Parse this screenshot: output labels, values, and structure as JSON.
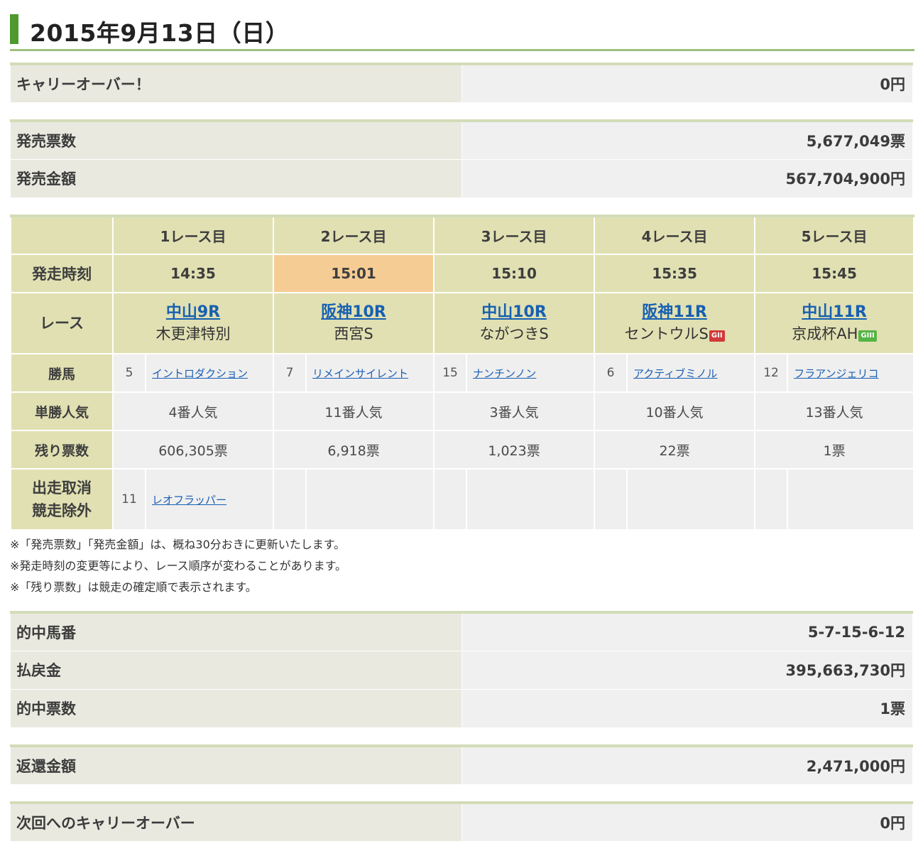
{
  "title": "2015年9月13日（日）",
  "carryover": {
    "label": "キャリーオーバー！",
    "value": "0円"
  },
  "sales": [
    {
      "label": "発売票数",
      "value": "5,677,049票"
    },
    {
      "label": "発売金額",
      "value": "567,704,900円"
    }
  ],
  "race_table": {
    "headers": [
      "1レース目",
      "2レース目",
      "3レース目",
      "4レース目",
      "5レース目"
    ],
    "time_label": "発走時刻",
    "times": [
      "14:35",
      "15:01",
      "15:10",
      "15:35",
      "15:45"
    ],
    "race_label": "レース",
    "races": [
      {
        "venue": "中山9R",
        "name": "木更津特別",
        "grade": ""
      },
      {
        "venue": "阪神10R",
        "name": "西宮S",
        "grade": ""
      },
      {
        "venue": "中山10R",
        "name": "ながつきS",
        "grade": ""
      },
      {
        "venue": "阪神11R",
        "name": "セントウルS",
        "grade": "GII",
        "grade_color": "#d23a3a"
      },
      {
        "venue": "中山11R",
        "name": "京成杯AH",
        "grade": "GIII",
        "grade_color": "#55b445"
      }
    ],
    "winner_label": "勝馬",
    "winners": [
      {
        "num": "5",
        "horse": "イントロダクション"
      },
      {
        "num": "7",
        "horse": "リメインサイレント"
      },
      {
        "num": "15",
        "horse": "ナンチンノン"
      },
      {
        "num": "6",
        "horse": "アクティブミノル"
      },
      {
        "num": "12",
        "horse": "フラアンジェリコ"
      }
    ],
    "popularity_label": "単勝人気",
    "popularity": [
      "4番人気",
      "11番人気",
      "3番人気",
      "10番人気",
      "13番人気"
    ],
    "remaining_label": "残り票数",
    "remaining": [
      "606,305票",
      "6,918票",
      "1,023票",
      "22票",
      "1票"
    ],
    "scratch_label_1": "出走取消",
    "scratch_label_2": "競走除外",
    "scratch": {
      "num": "11",
      "horse": "レオフラッパー"
    }
  },
  "notes": [
    "※「発売票数」「発売金額」は、概ね30分おきに更新いたします。",
    "※発走時刻の変更等により、レース順序が変わることがあります。",
    "※「残り票数」は競走の確定順で表示されます。"
  ],
  "results": [
    {
      "label": "的中馬番",
      "value": "5-7-15-6-12"
    },
    {
      "label": "払戻金",
      "value": "395,663,730円"
    },
    {
      "label": "的中票数",
      "value": "1票"
    }
  ],
  "refund": {
    "label": "返還金額",
    "value": "2,471,000円"
  },
  "next_carryover": {
    "label": "次回へのキャリーオーバー",
    "value": "0円"
  },
  "colors": {
    "accent_green": "#4e9a2e",
    "header_bg": "#e0e0b3",
    "current_race": "#f6cc95",
    "link": "#1a5fb4"
  }
}
